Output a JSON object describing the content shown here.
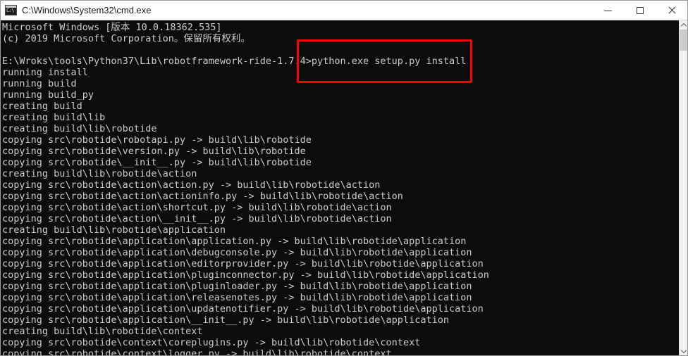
{
  "window": {
    "title": "C:\\Windows\\System32\\cmd.exe",
    "icon": "cmd-console-icon",
    "icon_text": "C:\\",
    "background_color": "#0c0c0c",
    "text_color": "#cccccc",
    "titlebar_color": "#ffffff"
  },
  "titlebar_buttons": {
    "minimize": "minimize-icon",
    "maximize": "maximize-icon",
    "close": "close-icon"
  },
  "annotation": {
    "type": "rectangle-highlight",
    "color": "#fe0000",
    "target_text": "python.exe setup.py install"
  },
  "scrollbar": {
    "up_arrow": "chevron-up-icon",
    "down_arrow": "chevron-down-icon",
    "thumb_position": "top"
  },
  "console": {
    "prompt": "E:\\Wroks\\tools\\Python37\\Lib\\robotframework-ride-1.7.4>",
    "command": "python.exe setup.py install",
    "lines": [
      "Microsoft Windows [版本 10.0.18362.535]",
      "(c) 2019 Microsoft Corporation。保留所有权利。",
      "",
      "E:\\Wroks\\tools\\Python37\\Lib\\robotframework-ride-1.7.4>python.exe setup.py install",
      "running install",
      "running build",
      "running build_py",
      "creating build",
      "creating build\\lib",
      "creating build\\lib\\robotide",
      "copying src\\robotide\\robotapi.py -> build\\lib\\robotide",
      "copying src\\robotide\\version.py -> build\\lib\\robotide",
      "copying src\\robotide\\__init__.py -> build\\lib\\robotide",
      "creating build\\lib\\robotide\\action",
      "copying src\\robotide\\action\\action.py -> build\\lib\\robotide\\action",
      "copying src\\robotide\\action\\actioninfo.py -> build\\lib\\robotide\\action",
      "copying src\\robotide\\action\\shortcut.py -> build\\lib\\robotide\\action",
      "copying src\\robotide\\action\\__init__.py -> build\\lib\\robotide\\action",
      "creating build\\lib\\robotide\\application",
      "copying src\\robotide\\application\\application.py -> build\\lib\\robotide\\application",
      "copying src\\robotide\\application\\debugconsole.py -> build\\lib\\robotide\\application",
      "copying src\\robotide\\application\\editorprovider.py -> build\\lib\\robotide\\application",
      "copying src\\robotide\\application\\pluginconnector.py -> build\\lib\\robotide\\application",
      "copying src\\robotide\\application\\pluginloader.py -> build\\lib\\robotide\\application",
      "copying src\\robotide\\application\\releasenotes.py -> build\\lib\\robotide\\application",
      "copying src\\robotide\\application\\updatenotifier.py -> build\\lib\\robotide\\application",
      "copying src\\robotide\\application\\__init__.py -> build\\lib\\robotide\\application",
      "creating build\\lib\\robotide\\context",
      "copying src\\robotide\\context\\coreplugins.py -> build\\lib\\robotide\\context",
      "copying src\\robotide\\context\\logger.py -> build\\lib\\robotide\\context"
    ]
  }
}
